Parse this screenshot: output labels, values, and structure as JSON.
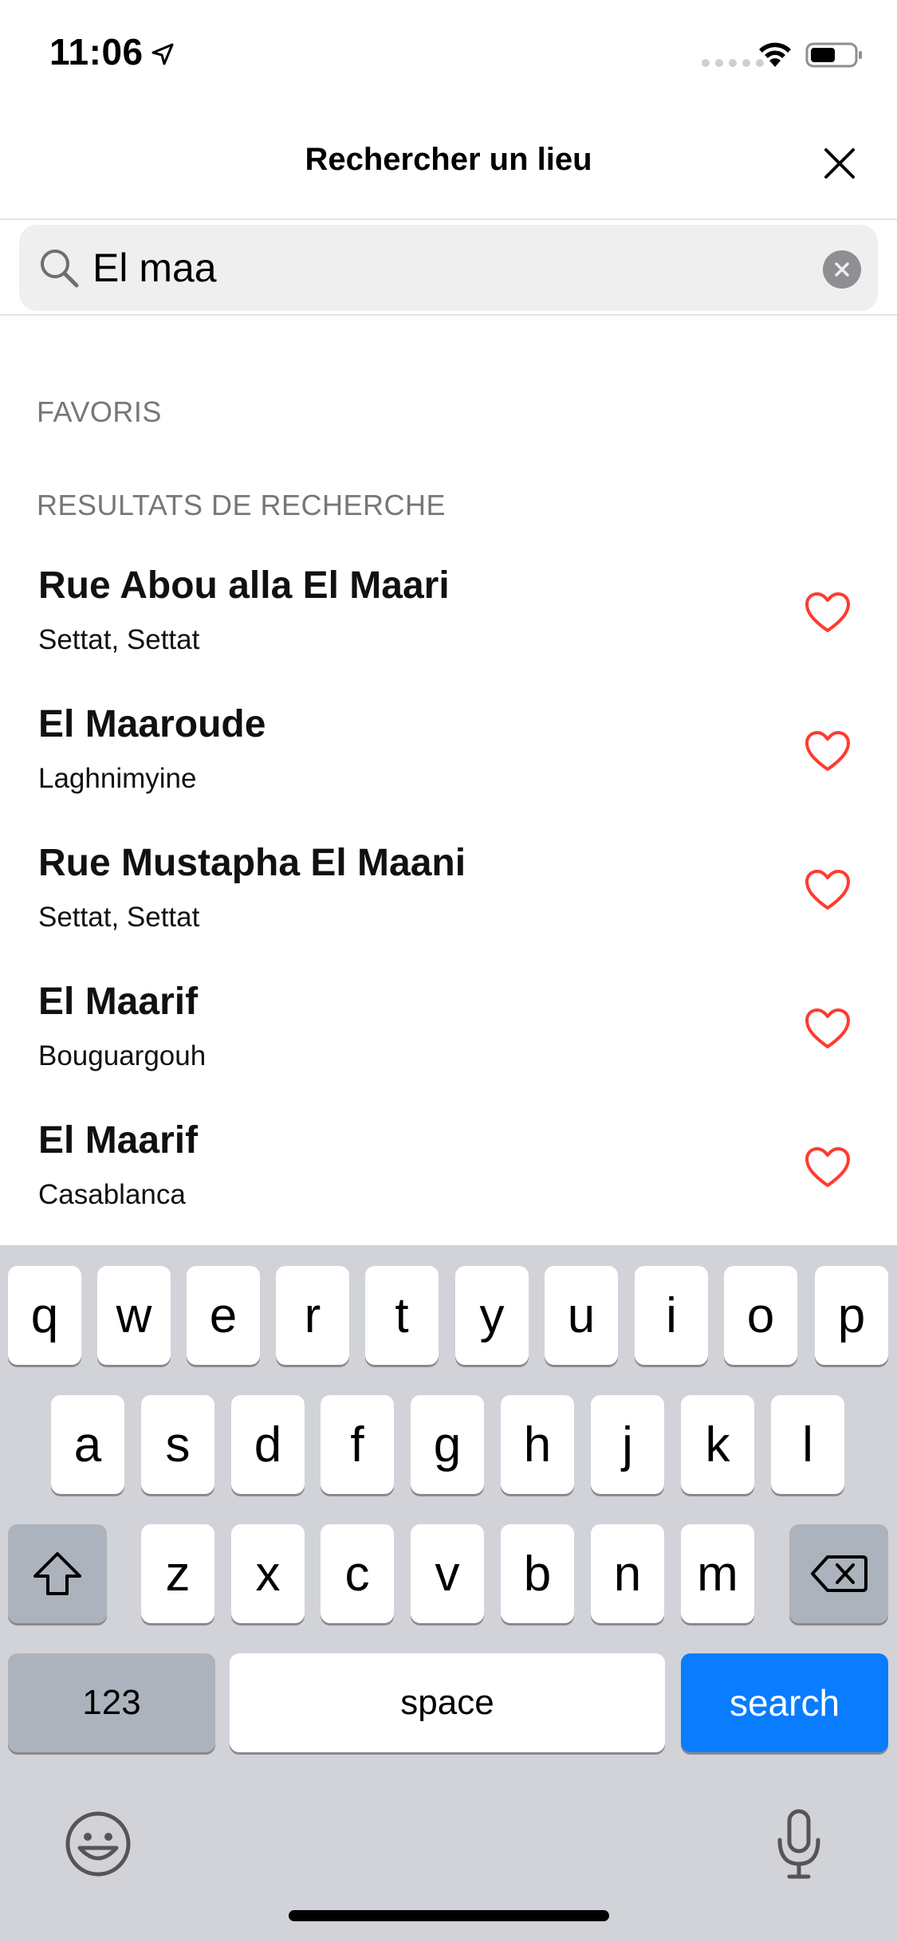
{
  "status_bar": {
    "time": "11:06",
    "icons": [
      "location-arrow-icon",
      "cellular-signal-icon",
      "wifi-icon",
      "battery-icon"
    ]
  },
  "header": {
    "title": "Rechercher un lieu",
    "close_icon": "close-icon"
  },
  "search": {
    "value": "El maa",
    "placeholder": "",
    "icon": "search-icon",
    "clear_icon": "clear-icon"
  },
  "sections": {
    "favorites_title": "FAVORIS",
    "results_title": "RESULTATS DE RECHERCHE"
  },
  "results": [
    {
      "name": "Rue Abou alla El Maari",
      "subtitle": "Settat, Settat"
    },
    {
      "name": "El Maaroude",
      "subtitle": "Laghnimyine"
    },
    {
      "name": "Rue Mustapha El Maani",
      "subtitle": "Settat, Settat"
    },
    {
      "name": "El Maarif",
      "subtitle": "Bouguargouh"
    },
    {
      "name": "El Maarif",
      "subtitle": "Casablanca"
    }
  ],
  "colors": {
    "heart": "#ff3b30",
    "search_key": "#0a7cff",
    "keyboard_bg": "#d1d3d9"
  },
  "keyboard": {
    "row1": [
      "q",
      "w",
      "e",
      "r",
      "t",
      "y",
      "u",
      "i",
      "o",
      "p"
    ],
    "row2": [
      "a",
      "s",
      "d",
      "f",
      "g",
      "h",
      "j",
      "k",
      "l"
    ],
    "row3": [
      "z",
      "x",
      "c",
      "v",
      "b",
      "n",
      "m"
    ],
    "numbers_label": "123",
    "space_label": "space",
    "action_label": "search"
  }
}
